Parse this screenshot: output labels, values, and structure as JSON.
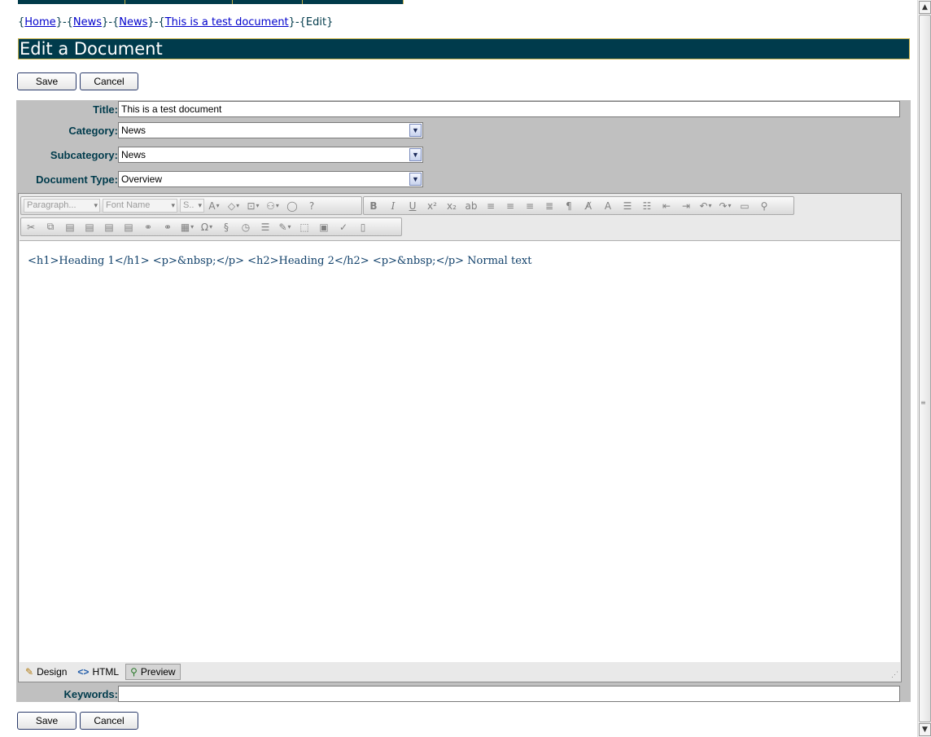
{
  "breadcrumb": {
    "items": [
      "Home",
      "News",
      "News",
      "This is a test document"
    ],
    "current": "Edit"
  },
  "page": {
    "title": "Edit a Document"
  },
  "buttons": {
    "save": "Save",
    "cancel": "Cancel"
  },
  "form": {
    "title_label": "Title:",
    "title_value": "This is a test document",
    "category_label": "Category:",
    "category_value": "News",
    "subcategory_label": "Subcategory:",
    "subcategory_value": "News",
    "doctype_label": "Document Type:",
    "doctype_value": "Overview",
    "keywords_label": "Keywords:",
    "keywords_value": ""
  },
  "editor": {
    "paragraph_dropdown": "Paragraph...",
    "font_dropdown": "Font Name",
    "size_dropdown": "S..",
    "content": "<h1>Heading 1</h1> <p>&nbsp;</p> <h2>Heading 2</h2> <p>&nbsp;</p> Normal text",
    "modes": {
      "design": "Design",
      "html": "HTML",
      "preview": "Preview"
    },
    "active_mode": "Preview"
  },
  "colors": {
    "header_bg": "#003b4c",
    "accent_border": "#c8b24a",
    "label": "#003b4c",
    "panel": "#c0c0c0"
  },
  "icons": [
    "bold-icon",
    "italic-icon",
    "underline-icon",
    "cut-icon",
    "copy-icon",
    "paste-icon",
    "table-icon",
    "omega-icon",
    "spellcheck-icon",
    "find-icon",
    "undo-icon",
    "redo-icon"
  ]
}
